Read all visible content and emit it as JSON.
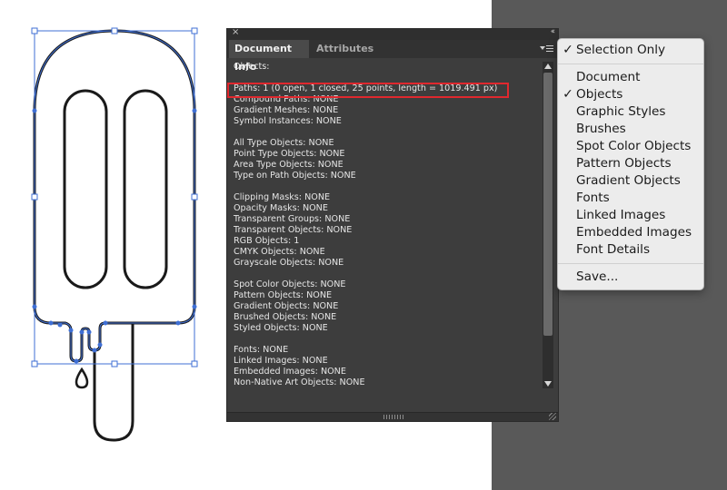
{
  "panel": {
    "close_glyph": "×",
    "collapse_glyph": "‹‹",
    "tabs": [
      "Document Info",
      "Attributes"
    ],
    "active_tab": "Document Info",
    "info_lines": [
      "Objects:",
      "",
      "Paths: 1 (0 open, 1 closed, 25 points, length = 1019.491 px)",
      "Compound Paths: NONE",
      "Gradient Meshes: NONE",
      "Symbol Instances: NONE",
      "",
      "All Type Objects: NONE",
      "Point Type Objects: NONE",
      "Area Type Objects: NONE",
      "Type on Path Objects: NONE",
      "",
      "Clipping Masks: NONE",
      "Opacity Masks: NONE",
      "Transparent Groups: NONE",
      "Transparent Objects: NONE",
      "RGB Objects: 1",
      "CMYK Objects: NONE",
      "Grayscale Objects: NONE",
      "",
      "Spot Color Objects: NONE",
      "Pattern Objects: NONE",
      "Gradient Objects: NONE",
      "Brushed Objects: NONE",
      "Styled Objects: NONE",
      "",
      "Fonts: NONE",
      "Linked Images: NONE",
      "Embedded Images: NONE",
      "Non-Native Art Objects: NONE"
    ],
    "highlighted_line": "Paths: 1 (0 open, 1 closed, 25 points, length = 1019.491 px)"
  },
  "menu": {
    "check_glyph": "✓",
    "groups": [
      [
        {
          "label": "Selection Only",
          "checked": true
        }
      ],
      [
        {
          "label": "Document",
          "checked": false
        },
        {
          "label": "Objects",
          "checked": true
        },
        {
          "label": "Graphic Styles",
          "checked": false
        },
        {
          "label": "Brushes",
          "checked": false
        },
        {
          "label": "Spot Color Objects",
          "checked": false
        },
        {
          "label": "Pattern Objects",
          "checked": false
        },
        {
          "label": "Gradient Objects",
          "checked": false
        },
        {
          "label": "Fonts",
          "checked": false
        },
        {
          "label": "Linked Images",
          "checked": false
        },
        {
          "label": "Embedded Images",
          "checked": false
        },
        {
          "label": "Font Details",
          "checked": false
        }
      ],
      [
        {
          "label": "Save...",
          "checked": false
        }
      ]
    ]
  },
  "colors": {
    "selection": "#3f6fd4",
    "highlight_box": "#e0282e",
    "panel_bg": "#3d3d3d",
    "pasteboard": "#595959"
  },
  "icons": {
    "panel_menu": "panel-menu-icon",
    "close": "close-icon",
    "collapse": "collapse-icon"
  }
}
